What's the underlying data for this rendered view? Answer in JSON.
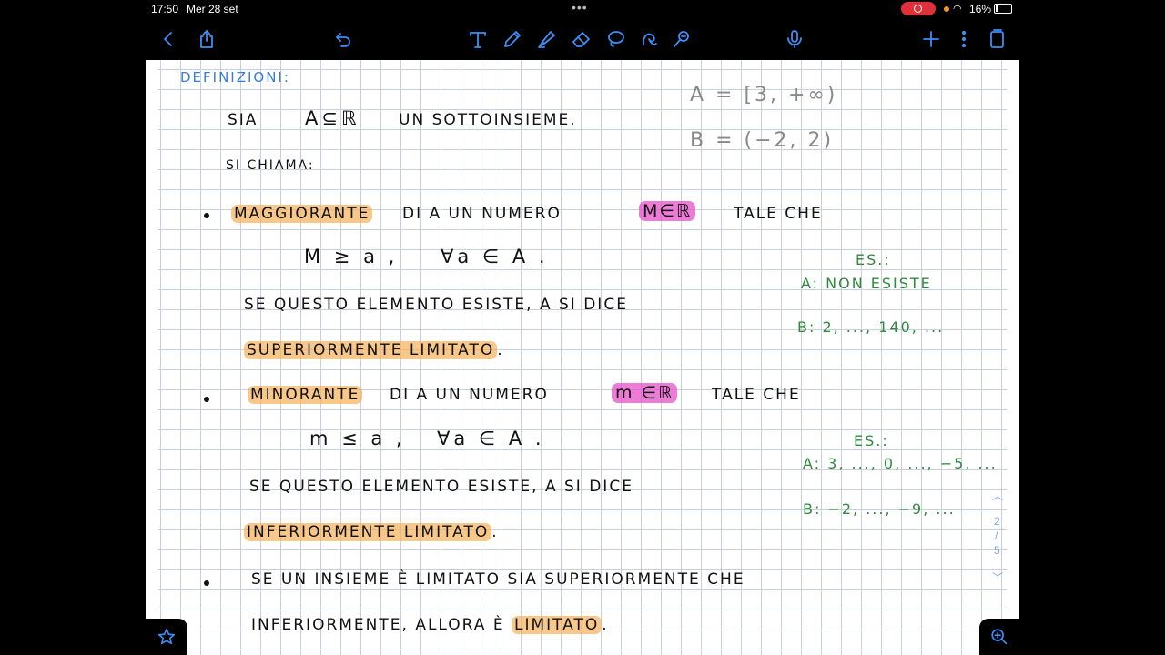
{
  "status": {
    "time": "17:50",
    "date": "Mer 28 set",
    "battery": "16%"
  },
  "toolbar": {
    "icons": [
      "back-icon",
      "share-icon",
      "undo-icon",
      "text-tool-icon",
      "pen-icon",
      "highlighter-icon",
      "eraser-icon",
      "lasso-icon",
      "shape-icon",
      "laser-pointer-icon",
      "microphone-icon",
      "add-icon",
      "more-icon",
      "pages-icon"
    ]
  },
  "note": {
    "heading": "DEFINIZIONI:",
    "line_sia_a": "SIA",
    "line_sia_b": "A⊆ℝ",
    "line_sia_c": "UN SOTTOINSIEME.",
    "side_A": "A =  [3, +∞)",
    "side_B": "B =  (−2, 2)",
    "si_chiama": "SI CHIAMA:",
    "magg_term": "MAGGIORANTE",
    "magg_mid": "DI  A  UN  NUMERO",
    "magg_sym": "M∈ℝ",
    "magg_end": "TALE  CHE",
    "magg_cond_1": "M ≥ a ,",
    "magg_cond_2": "∀a ∈ A .",
    "se_questo_1": "SE  QUESTO  ELEMENTO  ESISTE,  A  SI  DICE",
    "sup_lim": "SUPERIORMENTE  LIMITATO",
    "dot1": ".",
    "es1_label": "ES.:",
    "es1_a": "A:  NON  ESISTE",
    "es1_b": "B:  2, ..., 140, ...",
    "min_term": "MINORANTE",
    "min_mid": "DI  A  UN  NUMERO",
    "min_sym": "m ∈ℝ",
    "min_end": "TALE  CHE",
    "min_cond_1": "m ≤ a ,",
    "min_cond_2": "∀a ∈ A .",
    "se_questo_2": "SE  QUESTO  ELEMENTO  ESISTE,  A  SI  DICE",
    "inf_lim": "INFERIORMENTE  LIMITATO",
    "dot2": ".",
    "es2_label": "ES.:",
    "es2_a": "A:  3, ..., 0, ..., −5, ...",
    "es2_b": "B:  −2, ..., −9, ...",
    "line_last_1": "SE  UN  INSIEME  È  LIMITATO  SIA  SUPERIORMENTE  CHE",
    "line_last_2a": "INFERIORMENTE,  ALLORA  È",
    "line_last_2b": "LIMITATO",
    "dot3": "."
  },
  "pager": {
    "current": "2",
    "separator": "/",
    "total": "5"
  }
}
